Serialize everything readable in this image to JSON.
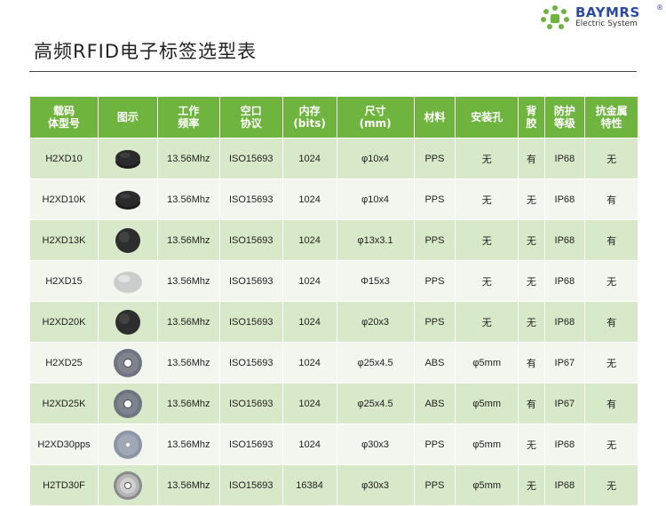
{
  "brand": {
    "name": "BAYMRS",
    "reg_mark": "®",
    "subtitle": "Electric System",
    "accent": "#6fb43f",
    "brand_color": "#2c4aa0"
  },
  "page": {
    "title": "高频RFID电子标签选型表"
  },
  "table": {
    "headers": [
      [
        "载码",
        "体型号"
      ],
      [
        "图示"
      ],
      [
        "工作",
        "频率"
      ],
      [
        "空口",
        "协议"
      ],
      [
        "内存",
        "(bits)"
      ],
      [
        "尺寸",
        "(mm)"
      ],
      [
        "材料"
      ],
      [
        "安装孔"
      ],
      [
        "背",
        "胶"
      ],
      [
        "防护",
        "等级"
      ],
      [
        "抗金属",
        "特性"
      ]
    ],
    "rows": [
      {
        "model": "H2XD10",
        "icon": "black-disc-icon",
        "freq": "13.56Mhz",
        "protocol": "ISO15693",
        "memory": "1024",
        "size": "φ10x4",
        "material": "PPS",
        "hole": "无",
        "adhesive": "有",
        "ip": "IP68",
        "anti_metal": "无"
      },
      {
        "model": "H2XD10K",
        "icon": "black-disc-icon",
        "freq": "13.56Mhz",
        "protocol": "ISO15693",
        "memory": "1024",
        "size": "φ10x4",
        "material": "PPS",
        "hole": "无",
        "adhesive": "无",
        "ip": "IP68",
        "anti_metal": "有"
      },
      {
        "model": "H2XD13K",
        "icon": "dark-disc-icon",
        "freq": "13.56Mhz",
        "protocol": "ISO15693",
        "memory": "1024",
        "size": "φ13x3.1",
        "material": "PPS",
        "hole": "无",
        "adhesive": "无",
        "ip": "IP68",
        "anti_metal": "有"
      },
      {
        "model": "H2XD15",
        "icon": "gray-disc-icon",
        "freq": "13.56Mhz",
        "protocol": "ISO15693",
        "memory": "1024",
        "size": "Φ15x3",
        "material": "PPS",
        "hole": "无",
        "adhesive": "无",
        "ip": "IP68",
        "anti_metal": "无"
      },
      {
        "model": "H2XD20K",
        "icon": "dark-disc-icon",
        "freq": "13.56Mhz",
        "protocol": "ISO15693",
        "memory": "1024",
        "size": "φ20x3",
        "material": "PPS",
        "hole": "无",
        "adhesive": "无",
        "ip": "IP68",
        "anti_metal": "有"
      },
      {
        "model": "H2XD25",
        "icon": "ring-disc-icon",
        "freq": "13.56Mhz",
        "protocol": "ISO15693",
        "memory": "1024",
        "size": "φ25x4.5",
        "material": "ABS",
        "hole": "φ5mm",
        "adhesive": "有",
        "ip": "IP67",
        "anti_metal": "无"
      },
      {
        "model": "H2XD25K",
        "icon": "ring-disc-icon",
        "freq": "13.56Mhz",
        "protocol": "ISO15693",
        "memory": "1024",
        "size": "φ25x4.5",
        "material": "ABS",
        "hole": "φ5mm",
        "adhesive": "有",
        "ip": "IP67",
        "anti_metal": "有"
      },
      {
        "model": "H2XD30pps",
        "icon": "ring-disc-light-icon",
        "freq": "13.56Mhz",
        "protocol": "ISO15693",
        "memory": "1024",
        "size": "φ30x3",
        "material": "PPS",
        "hole": "φ5mm",
        "adhesive": "无",
        "ip": "IP68",
        "anti_metal": "无"
      },
      {
        "model": "H2TD30F",
        "icon": "metal-ring-disc-icon",
        "freq": "13.56Mhz",
        "protocol": "ISO15693",
        "memory": "16384",
        "size": "φ30x3",
        "material": "PPS",
        "hole": "φ5mm",
        "adhesive": "无",
        "ip": "IP68",
        "anti_metal": "无"
      }
    ]
  }
}
